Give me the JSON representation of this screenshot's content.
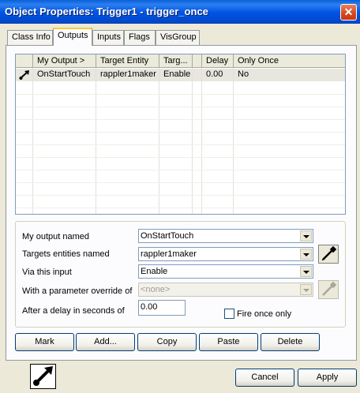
{
  "window": {
    "title": "Object Properties: Trigger1 - trigger_once",
    "close_glyph": "✕"
  },
  "tabs": [
    {
      "label": "Class Info"
    },
    {
      "label": "Outputs",
      "active": true
    },
    {
      "label": "Inputs"
    },
    {
      "label": "Flags"
    },
    {
      "label": "VisGroup"
    }
  ],
  "outputs_list": {
    "columns": [
      "My Output >",
      "Target Entity",
      "Targ...",
      "Delay",
      "Only Once"
    ],
    "rows": [
      {
        "icon": "output-arrow-icon",
        "my_output": "OnStartTouch",
        "target_entity": "rappler1maker",
        "target_input": "Enable",
        "delay": "0.00",
        "only_once": "No"
      }
    ]
  },
  "editor": {
    "output_label": "My output named",
    "output_value": "OnStartTouch",
    "target_label": "Targets entities named",
    "target_value": "rappler1maker",
    "input_label": "Via this input",
    "input_value": "Enable",
    "param_label": "With a parameter override of",
    "param_value": "<none>",
    "delay_label": "After a delay in seconds of",
    "delay_value": "0.00",
    "fire_once_label": "Fire once only",
    "fire_once_checked": false
  },
  "action_buttons": {
    "mark": "Mark",
    "add": "Add...",
    "copy": "Copy",
    "paste": "Paste",
    "delete": "Delete"
  },
  "footer": {
    "icon": "output-arrow-icon",
    "cancel": "Cancel",
    "apply": "Apply"
  },
  "colors": {
    "titlebar": "#0054e3",
    "face": "#ece9d8",
    "selected_row": "#e8e7df",
    "border": "#7f9db9"
  }
}
